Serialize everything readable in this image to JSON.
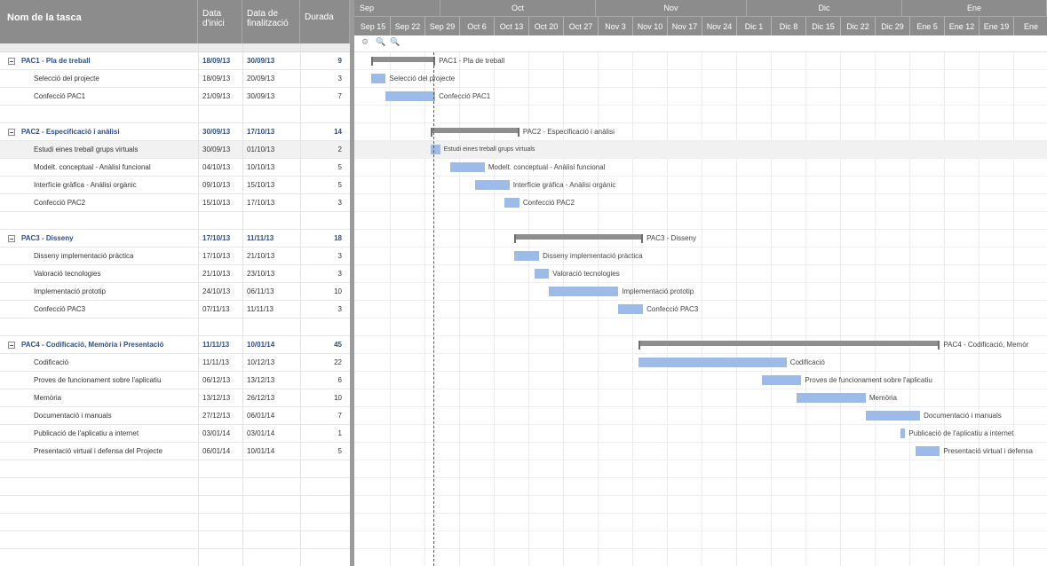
{
  "columns": {
    "name": "Nom de la tasca",
    "start": "Data d'inici",
    "end": "Data de finalització",
    "duration": "Durada"
  },
  "timeline": {
    "months": [
      "Sep",
      "Oct",
      "Nov",
      "Dic",
      "Ene"
    ],
    "weeks": [
      "Sep 15",
      "Sep 22",
      "Sep 29",
      "Oct 6",
      "Oct 13",
      "Oct 20",
      "Oct 27",
      "Nov 3",
      "Nov 10",
      "Nov 17",
      "Nov 24",
      "Dic 1",
      "Dic 8",
      "Dic 15",
      "Dic 22",
      "Dic 29",
      "Ene 5",
      "Ene 12",
      "Ene 19",
      "Ene"
    ],
    "tools": [
      "⚙",
      "🔍",
      "🔍"
    ]
  },
  "tasks": [
    {
      "name": "PAC1 - Pla de treball",
      "start": "18/09/13",
      "end": "30/09/13",
      "duration": "9",
      "group": true,
      "label": "PAC1 - Pla de treball"
    },
    {
      "name": "Selecció del projecte",
      "start": "18/09/13",
      "end": "20/09/13",
      "duration": "3",
      "label": "Selecció del projecte"
    },
    {
      "name": "Confecció PAC1",
      "start": "21/09/13",
      "end": "30/09/13",
      "duration": "7",
      "label": "Confecció PAC1"
    },
    {
      "name": "",
      "start": "",
      "end": "",
      "duration": "",
      "empty": true
    },
    {
      "name": "PAC2 - Especificació i anàlisi",
      "start": "30/09/13",
      "end": "17/10/13",
      "duration": "14",
      "group": true,
      "label": "PAC2 - Especificació i anàlisi"
    },
    {
      "name": "Estudi eines treball grups virtuals",
      "start": "30/09/13",
      "end": "01/10/13",
      "duration": "2",
      "selected": true,
      "label": "Estudi eines treball grups virtuals"
    },
    {
      "name": "Modelt. conceptual - Anàlisi funcional",
      "start": "04/10/13",
      "end": "10/10/13",
      "duration": "5",
      "label": "Modelt. conceptual - Anàlisi funcional"
    },
    {
      "name": "Interfície gràfica - Anàlisi orgànic",
      "start": "09/10/13",
      "end": "15/10/13",
      "duration": "5",
      "label": "Interfície gràfica - Anàlisi orgànic"
    },
    {
      "name": "Confecció PAC2",
      "start": "15/10/13",
      "end": "17/10/13",
      "duration": "3",
      "label": "Confecció PAC2"
    },
    {
      "name": "",
      "start": "",
      "end": "",
      "duration": "",
      "empty": true
    },
    {
      "name": "PAC3 - Disseny",
      "start": "17/10/13",
      "end": "11/11/13",
      "duration": "18",
      "group": true,
      "label": "PAC3 - Disseny"
    },
    {
      "name": "Disseny implementació pràctica",
      "start": "17/10/13",
      "end": "21/10/13",
      "duration": "3",
      "label": "Disseny implementació pràctica"
    },
    {
      "name": "Valoració tecnologies",
      "start": "21/10/13",
      "end": "23/10/13",
      "duration": "3",
      "label": "Valoració tecnologies"
    },
    {
      "name": "Implementació prototip",
      "start": "24/10/13",
      "end": "06/11/13",
      "duration": "10",
      "label": "Implementació prototip"
    },
    {
      "name": "Confecció PAC3",
      "start": "07/11/13",
      "end": "11/11/13",
      "duration": "3",
      "label": "Confecció PAC3"
    },
    {
      "name": "",
      "start": "",
      "end": "",
      "duration": "",
      "empty": true
    },
    {
      "name": "PAC4 - Codificació, Memòria i Presentació",
      "start": "11/11/13",
      "end": "10/01/14",
      "duration": "45",
      "group": true,
      "label": "PAC4 - Codificació, Memòr"
    },
    {
      "name": "Codificació",
      "start": "11/11/13",
      "end": "10/12/13",
      "duration": "22",
      "label": "Codificació"
    },
    {
      "name": "Proves de funcionament sobre l'aplicatiu",
      "start": "06/12/13",
      "end": "13/12/13",
      "duration": "6",
      "label": "Proves de funcionament sobre l'aplicatiu"
    },
    {
      "name": "Memòria",
      "start": "13/12/13",
      "end": "26/12/13",
      "duration": "10",
      "label": "Memòria"
    },
    {
      "name": "Documentació i manuals",
      "start": "27/12/13",
      "end": "06/01/14",
      "duration": "7",
      "label": "Documentació i manuals"
    },
    {
      "name": "Publicació de l'aplicatiu a internet",
      "start": "03/01/14",
      "end": "03/01/14",
      "duration": "1",
      "label": "Publicació de l'aplicatiu a internet"
    },
    {
      "name": "Presentació virtual i defensa del Projecte",
      "start": "06/01/14",
      "end": "10/01/14",
      "duration": "5",
      "label": "Presentació virtual i defensa"
    }
  ]
}
